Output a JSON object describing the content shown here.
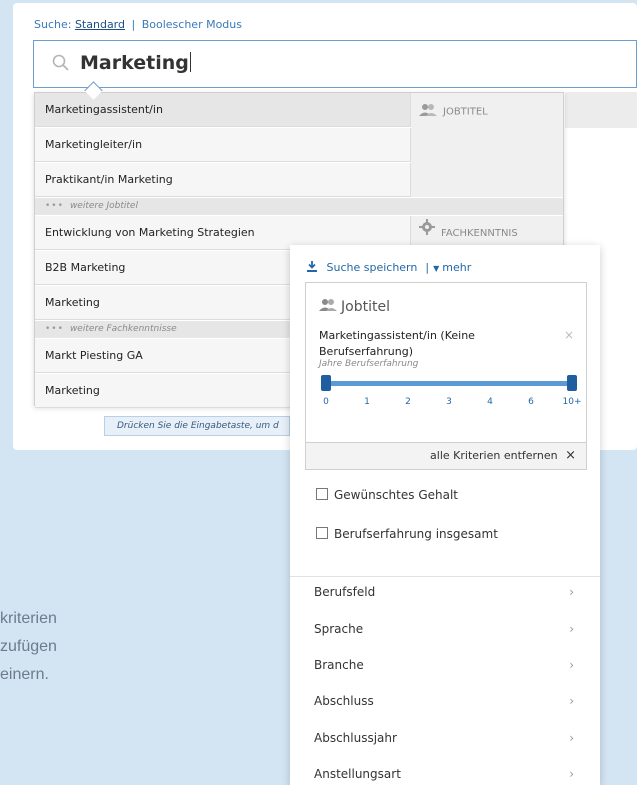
{
  "search": {
    "mode_label": "Suche:",
    "mode_standard": "Standard",
    "mode_separator": "|",
    "mode_boolean": "Boolescher Modus",
    "query": "Marketing"
  },
  "dropdown": {
    "categories": [
      {
        "name": "JOBTITEL",
        "icon": "people-icon"
      },
      {
        "name": "FACHKENNTNIS",
        "icon": "gear-icon"
      }
    ],
    "jobtitles": [
      "Marketingassistent/in",
      "Marketingleiter/in",
      "Praktikant/in Marketing"
    ],
    "more_jobtitles": "weitere Jobtitel",
    "skills": [
      "Entwicklung von Marketing Strategien",
      "B2B Marketing",
      "Marketing"
    ],
    "more_skills": "weitere Fachkenntnisse",
    "others": [
      "Markt Piesting GA",
      "Marketing"
    ],
    "dots": "•••"
  },
  "hint": "Drücken Sie die Eingabetaste, um d",
  "background_text": [
    "kriterien",
    "zufügen",
    "einern."
  ],
  "panel": {
    "save_search": "Suche speichern",
    "separator": "|",
    "more": "mehr",
    "job_card": {
      "title": "Jobtitel",
      "name": "Marketingassistent/in (Keine Berufserfahrung)",
      "close": "×",
      "subtitle": "Jahre Berufserfahrung",
      "slider_ticks": [
        "0",
        "1",
        "2",
        "3",
        "4",
        "6",
        "10+"
      ],
      "slider_range": [
        0,
        1
      ]
    },
    "remove_all": "alle Kriterien entfernen",
    "remove_icon": "×",
    "checkboxes": [
      "Gewünschtes Gehalt",
      "Berufserfahrung insgesamt"
    ],
    "nav_items": [
      "Berufsfeld",
      "Sprache",
      "Branche",
      "Abschluss",
      "Abschlussjahr",
      "Anstellungsart"
    ],
    "chevron": "›"
  },
  "colors": {
    "accent": "#2467a7",
    "page_bg": "#d3e4f3",
    "search_border": "#6e9ecf"
  }
}
